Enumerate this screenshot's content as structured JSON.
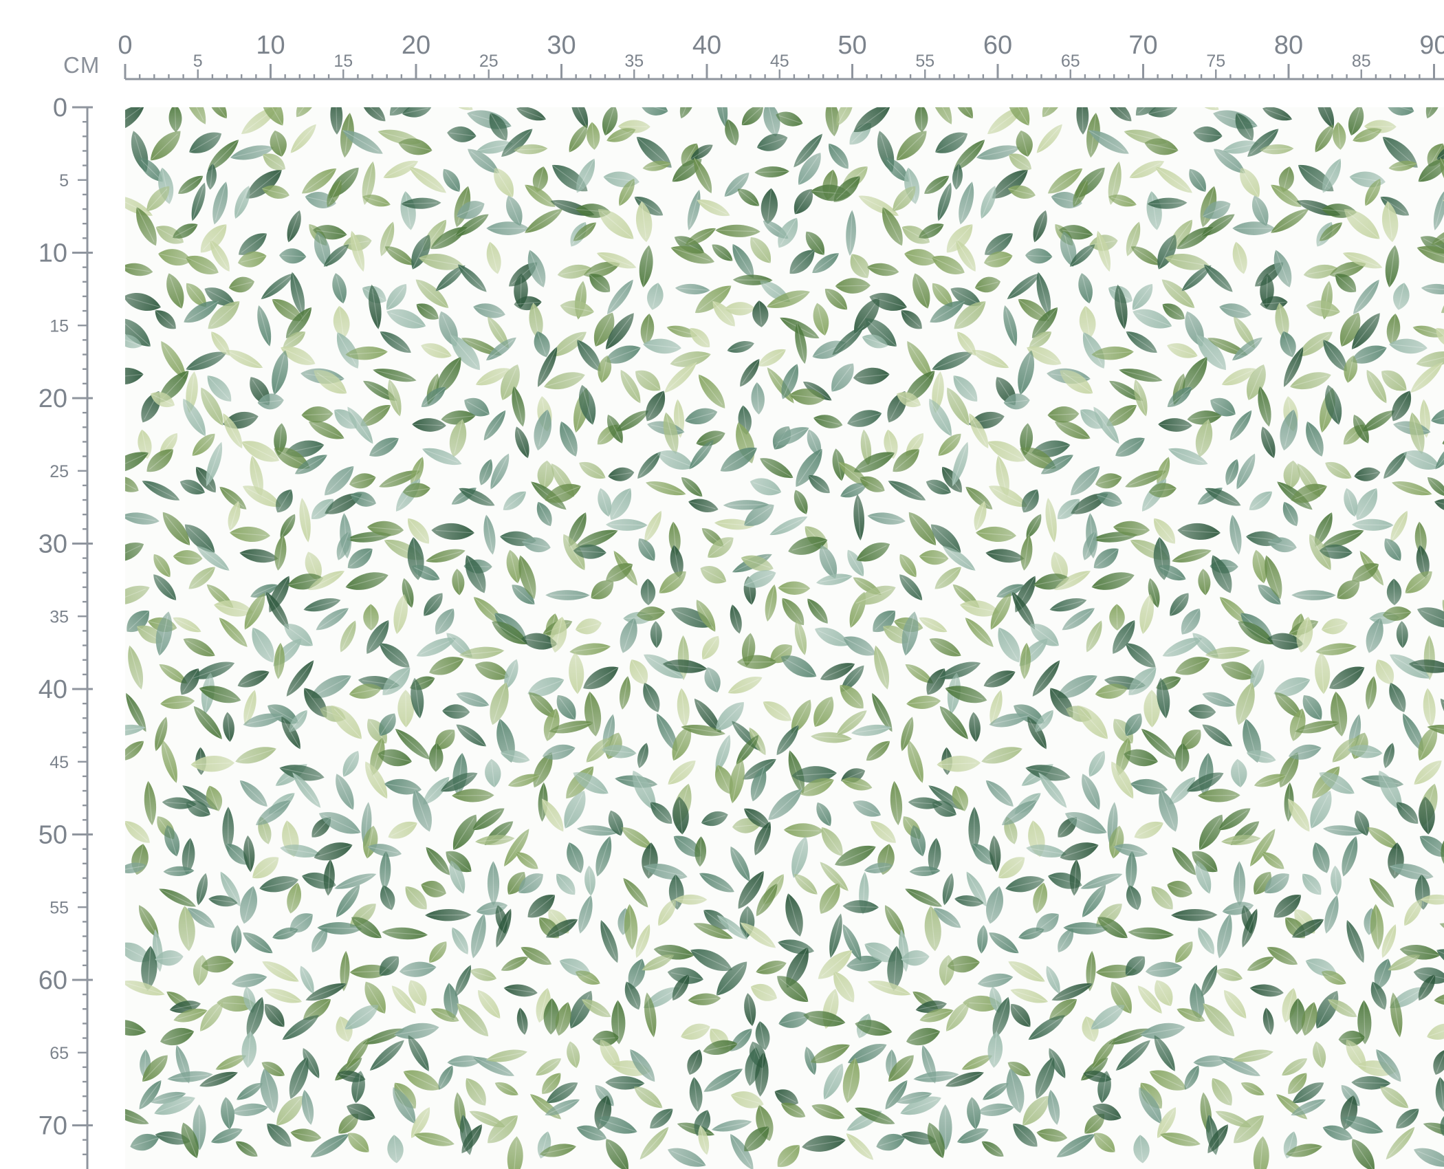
{
  "ruler": {
    "unit": "CM",
    "horizontal_labels": [
      "0",
      "5",
      "10",
      "15",
      "20",
      "25",
      "30",
      "35",
      "40",
      "45",
      "50",
      "55",
      "60",
      "65",
      "70",
      "75",
      "80",
      "85",
      "90"
    ],
    "vertical_labels": [
      "0",
      "5",
      "10",
      "15",
      "20",
      "25",
      "30",
      "35",
      "40",
      "45",
      "50",
      "55",
      "60",
      "65",
      "70"
    ],
    "color": "#8f959e"
  },
  "fabric": {
    "pattern": "watercolor green leaves on white",
    "background_color": "#fbfcfa",
    "leaf_colors": [
      "#4f7a3f",
      "#6b8f4e",
      "#87a663",
      "#3f6b52",
      "#5e8a76",
      "#7ea394",
      "#9cbcae",
      "#2f5a3f",
      "#a9c08a",
      "#c7d6a6"
    ]
  }
}
